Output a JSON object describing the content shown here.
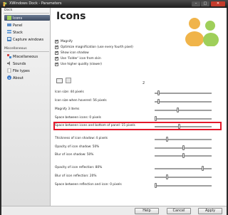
{
  "window": {
    "title": "XWindows Dock - Parameters"
  },
  "sidebar": {
    "section_dock": "Dock",
    "dock_items": [
      {
        "label": "Icons",
        "icon": "icons-icon",
        "active": true
      },
      {
        "label": "Panel",
        "icon": "panel-icon"
      },
      {
        "label": "Stack",
        "icon": "stack-icon"
      },
      {
        "label": "Capture windows",
        "icon": "capture-windows-icon"
      }
    ],
    "section_misc": "Miscellaneous",
    "misc_items": [
      {
        "label": "Miscellaneous",
        "icon": "misc-icon"
      },
      {
        "label": "Sounds",
        "icon": "sounds-icon"
      },
      {
        "label": "File types",
        "icon": "file-types-icon"
      },
      {
        "label": "About",
        "icon": "about-icon"
      }
    ]
  },
  "main": {
    "title": "Icons",
    "checkboxes": [
      {
        "label": "Magnify",
        "checked": true
      },
      {
        "label": "Optimize magnification (use every fourth pixel)",
        "checked": true
      },
      {
        "label": "Show icon shadow",
        "checked": true
      },
      {
        "label": "Use 'Folder' icon from skin",
        "checked": true
      },
      {
        "label": "Use higher quality (slower)",
        "checked": true
      }
    ],
    "color_value": "2",
    "sliders": [
      {
        "label": "Icon size: 44 pixels",
        "value": 0.05
      },
      {
        "label": "Icon size when hovered: 56 pixels",
        "value": 0.05
      },
      {
        "label": "Magnify 3 items",
        "value": 0.4
      },
      {
        "label": "Space between icons: 0 pixels",
        "value": 0.0
      },
      {
        "label": "Space between icons and bottom of panel: 15 pixels",
        "value": 0.42
      },
      {
        "label": "Thickness of icon shadow: 4 pixels",
        "value": 0.2
      },
      {
        "label": "Opacity of icon shadow: 50%",
        "value": 0.5
      },
      {
        "label": "Blur of icon shadow: 50%",
        "value": 0.5
      },
      {
        "label": "Opacity of icon reflection: 80%",
        "value": 0.85
      },
      {
        "label": "Blur of icon reflection: 20%",
        "value": 0.2
      },
      {
        "label": "Space between reflection and icon: 0 pixels",
        "value": 0.0
      }
    ]
  },
  "footer": {
    "help": "Help",
    "cancel": "Cancel",
    "apply": "Apply"
  },
  "colors": {
    "highlight": "#e3182a",
    "active_nav": "#3e4c63",
    "logo_orange": "#f0b44a",
    "logo_green": "#9fcf5a"
  }
}
